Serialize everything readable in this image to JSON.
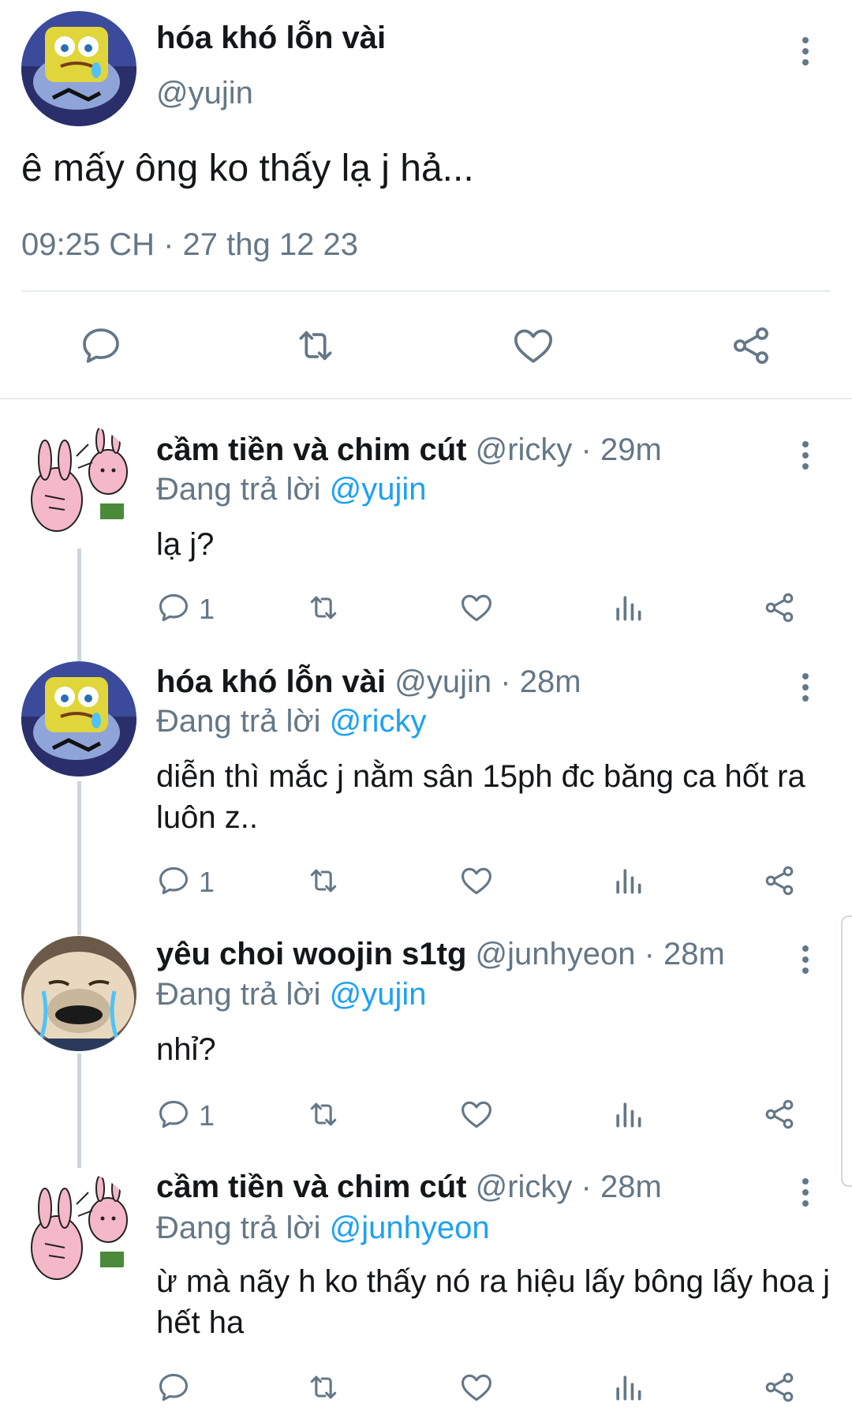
{
  "main_tweet": {
    "name": "hóa khó lỗn vài",
    "handle": "@yujin",
    "text": "ê mấy ông ko thấy lạ j hả...",
    "timestamp": "09:25 CH · 27 thg 12 23"
  },
  "replies": [
    {
      "name": "cầm tiền và chim cút",
      "handle": "@ricky",
      "time": "· 29m",
      "replying_label": "Đang trả lời",
      "replying_to": "@yujin",
      "text": "lạ j?",
      "reply_count": "1"
    },
    {
      "name": "hóa khó lỗn vài",
      "handle": "@yujin",
      "time": "· 28m",
      "replying_label": "Đang trả lời",
      "replying_to": "@ricky",
      "text": "diễn thì mắc j nằm sân 15ph đc băng ca hốt ra luôn z..",
      "reply_count": "1"
    },
    {
      "name": "yêu choi woojin s1tg",
      "handle": "@junhyeon",
      "time": "· 28m",
      "replying_label": "Đang trả lời",
      "replying_to": "@yujin",
      "text": "nhỉ?",
      "reply_count": "1"
    },
    {
      "name": "cầm tiền và chim cút",
      "handle": "@ricky",
      "time": "· 28m",
      "replying_label": "Đang trả lời",
      "replying_to": "@junhyeon",
      "text": "ừ mà nãy h ko thấy nó ra hiệu lấy bông lấy hoa j hết ha",
      "reply_count": ""
    }
  ],
  "colors": {
    "link": "#1da1f2",
    "muted": "#657786",
    "text": "#14171a",
    "divider": "#e6ecf0"
  },
  "icons": [
    "reply-icon",
    "retweet-icon",
    "like-icon",
    "analytics-icon",
    "share-icon",
    "more-icon"
  ]
}
